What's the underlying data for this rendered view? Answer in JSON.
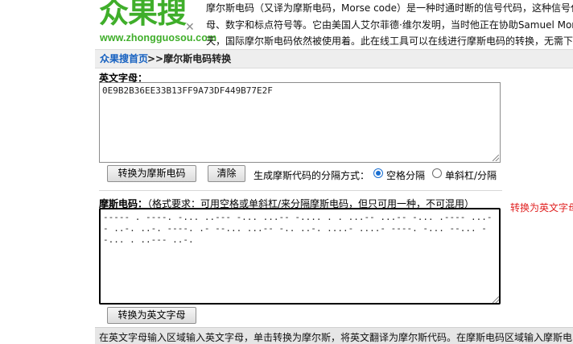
{
  "logo": {
    "brand": "众果搜",
    "url": "www.zhongguosou.com",
    "mark": "✕"
  },
  "intro": {
    "line1": "摩尔斯电码（又译为摩斯电码，Morse code）是一种时通时断的信号代码，这种信号代",
    "line2": "母、数字和标点符号等。它由美国人艾尔菲德·维尔发明，当时他正在协助Samuel Mor",
    "line3": "天，国际摩尔斯电码依然被使用着。此在线工具可以在线进行摩斯电码的转换，无需下"
  },
  "breadcrumb": {
    "home": "众果搜首页",
    "sep": ">>",
    "current": "摩尔斯电码转换"
  },
  "english": {
    "label": "英文字母：",
    "value": "0E9B2B36EE33B13FF9A73DF449B77E2F"
  },
  "toolbar": {
    "to_morse": "转换为摩斯电码",
    "clear": "清除",
    "separator_label": "生成摩斯代码的分隔方式：",
    "option_space": "空格分隔",
    "option_slash": "单斜杠/分隔",
    "selected": "space"
  },
  "morse": {
    "label": "摩斯电码：",
    "hint": "（格式要求：可用空格或单斜杠/来分隔摩斯电码，但只可用一种，不可混用）",
    "value": "----- . ----. -... ..--- -... ...-- -.... . . ...-- ...-- -... .---- ...-- ..-. ..-. ----. .- --... ...-- -.. ..-. ....- ....- ----. -... --... --... . ..--- ..-."
  },
  "convert_back": "转换为英文字母",
  "side_note": "转换为英文字母",
  "footer": "在英文字母输入区域输入英文字母，单击转换为摩尔斯，将英文翻译为摩尔斯代码。在摩斯电码区域输入摩斯电"
}
